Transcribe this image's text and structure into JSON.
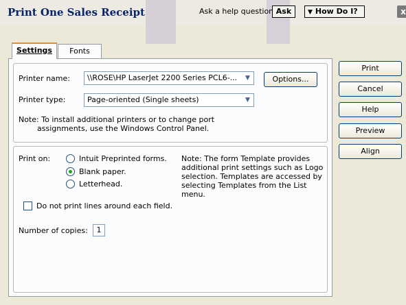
{
  "window": {
    "title": "Print One Sales Receipt",
    "help_label": "Ask a help question",
    "ask_label": "Ask",
    "howdo_label": "How Do I?",
    "close_label": "x"
  },
  "tabs": [
    {
      "label": "Settings",
      "active": true
    },
    {
      "label": "Fonts",
      "active": false
    }
  ],
  "printer": {
    "name_label": "Printer name:",
    "name_value": "\\\\ROSE\\HP LaserJet 2200 Series PCL6-...",
    "options_label": "Options...",
    "type_label": "Printer type:",
    "type_value": "Page-oriented (Single sheets)",
    "note_line1": "Note: To install additional printers or to change port",
    "note_line2": "assignments, use the Windows Control Panel."
  },
  "print_on": {
    "label": "Print on:",
    "options": [
      {
        "label": "Intuit Preprinted forms.",
        "selected": false
      },
      {
        "label": "Blank paper.",
        "selected": true
      },
      {
        "label": "Letterhead.",
        "selected": false
      }
    ],
    "note_lines": [
      "Note: The form Template provides",
      "additional print settings such as Logo",
      "selection.  Templates are accessed by",
      "selecting Templates from the List",
      "menu."
    ]
  },
  "no_lines": {
    "label": "Do not print lines around each field.",
    "checked": false
  },
  "copies": {
    "label": "Number of copies:",
    "value": "1"
  },
  "side_buttons": [
    {
      "label": "Print"
    },
    {
      "label": "Cancel"
    },
    {
      "label": "Help"
    },
    {
      "label": "Preview"
    },
    {
      "label": "Align"
    }
  ]
}
